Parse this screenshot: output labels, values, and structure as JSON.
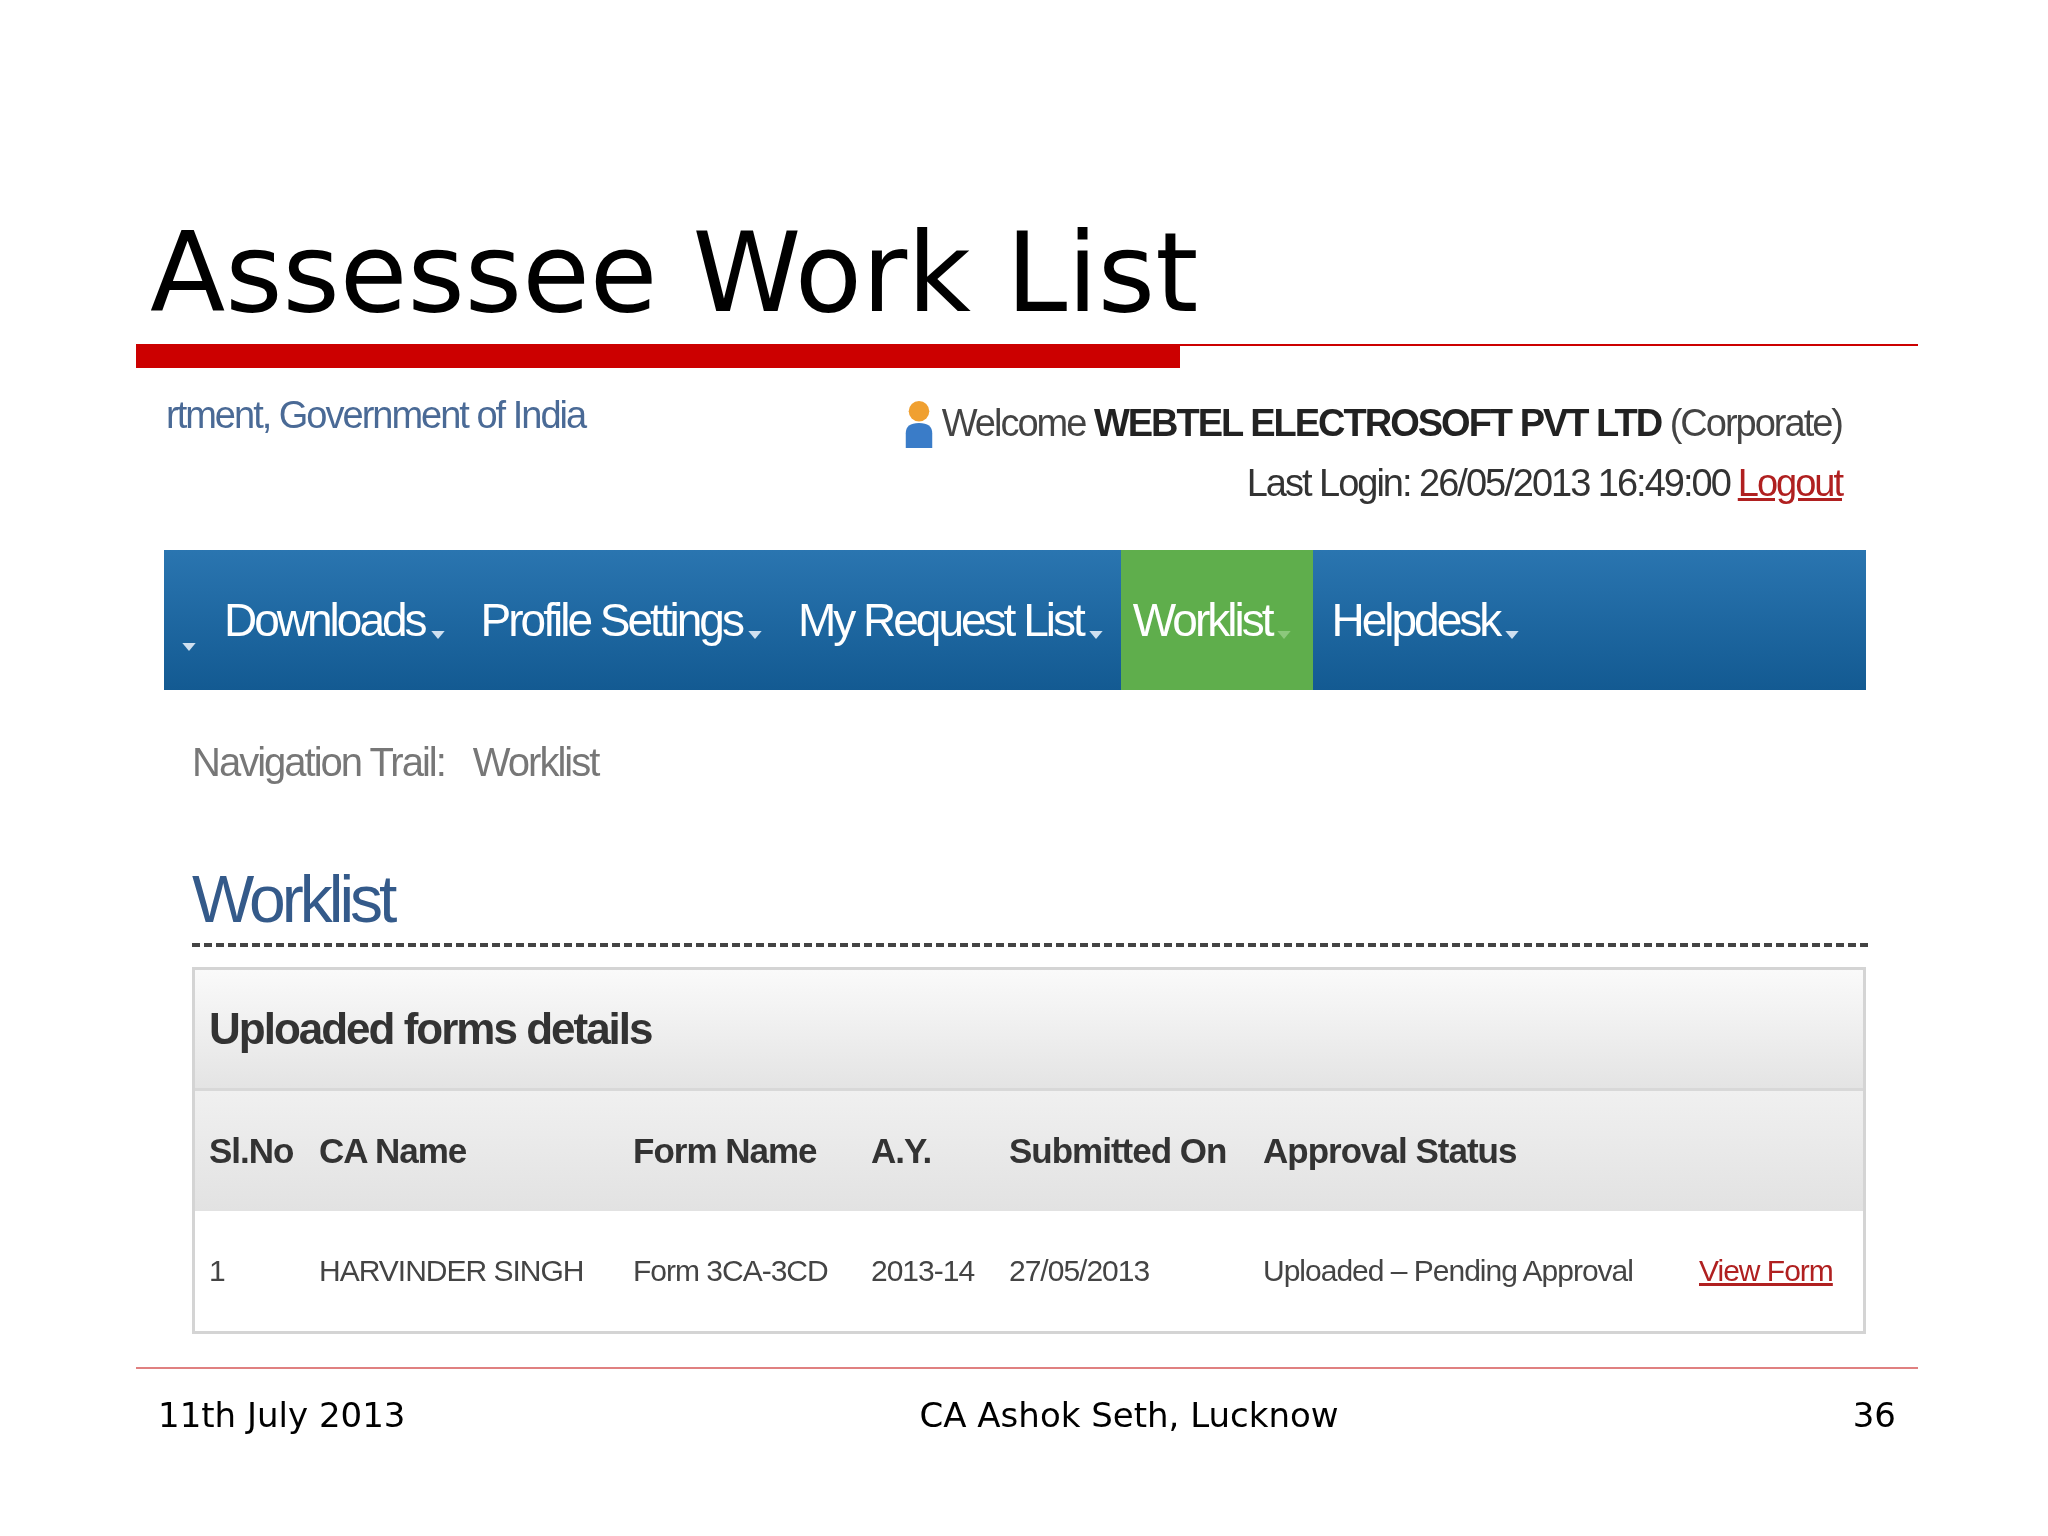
{
  "slide": {
    "title": "Assessee Work List",
    "footer": {
      "date": "11th July 2013",
      "author": "CA Ashok Seth, Lucknow",
      "page": "36"
    }
  },
  "screen": {
    "header": {
      "org_text": "rtment, Government of India",
      "welcome": "Welcome **WEBTEL ELECTROSOFT PVT LTD** (Corporate)",
      "last_login": "Last Login: 26/05/2013 16:49:00",
      "logout": "Logout"
    },
    "nav_items": [
      {
        "label": "Downloads",
        "selected": false
      },
      {
        "label": "Profile Settings",
        "selected": false
      },
      {
        "label": "My Request List",
        "selected": false
      },
      {
        "label": "Worklist",
        "selected": true
      },
      {
        "label": "Helpdesk",
        "selected": false
      }
    ],
    "breadcrumb": {
      "label": "Navigation Trail:",
      "value": "Worklist"
    },
    "heading": "Worklist",
    "panel": {
      "title": "Uploaded forms details",
      "columns": [
        "Sl.No",
        "CA Name",
        "Form Name",
        "A.Y.",
        "Submitted On",
        "Approval Status"
      ],
      "rows": [
        {
          "cells": [
            "1",
            "HARVINDER SINGH",
            "Form 3CA-3CD",
            "2013-14",
            "27/05/2013",
            "Uploaded – Pending Approval"
          ],
          "link": "View Form"
        }
      ]
    }
  }
}
